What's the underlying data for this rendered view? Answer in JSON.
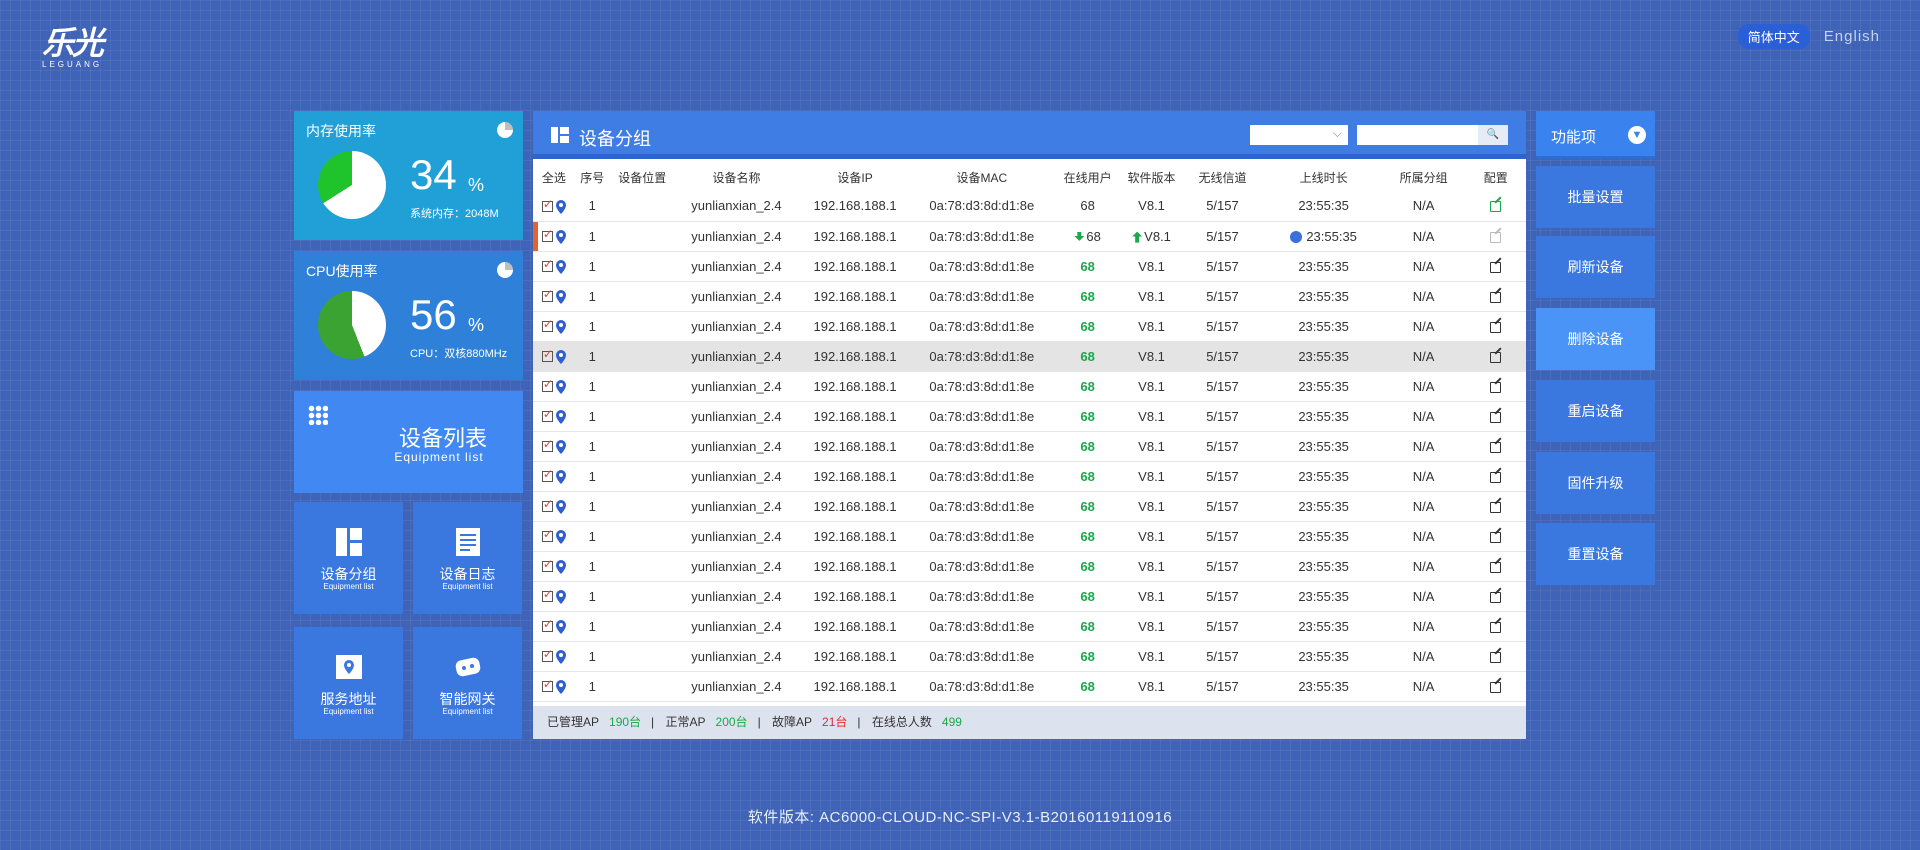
{
  "logo": {
    "mark": "乐光",
    "sub": "LEGUANG"
  },
  "language": {
    "zh": "简体中文",
    "en": "English"
  },
  "memory": {
    "title": "内存使用率",
    "value": "34",
    "unit": "%",
    "sub": "系统内存：2048M",
    "usage_percent": 34
  },
  "cpu": {
    "title": "CPU使用率",
    "value": "56",
    "unit": "%",
    "sub": "CPU：双核880MHz",
    "usage_percent": 56
  },
  "equipment_list": {
    "title": "设备列表",
    "sub": "Equipment list"
  },
  "tiles": [
    {
      "title": "设备分组",
      "sub": "Equipment list"
    },
    {
      "title": "设备日志",
      "sub": "Equipment list"
    },
    {
      "title": "服务地址",
      "sub": "Equipment list"
    },
    {
      "title": "智能网关",
      "sub": "Equipment list"
    }
  ],
  "panel": {
    "title": "设备分组",
    "search_icon": "search-icon",
    "columns": [
      "全选",
      "序号",
      "设备位置",
      "设备名称",
      "设备IP",
      "设备MAC",
      "在线用户",
      "软件版本",
      "无线信道",
      "上线时长",
      "所属分组",
      "配置"
    ],
    "rows": [
      {
        "index": "1",
        "name": "yunlianxian_2.4",
        "ip": "192.168.188.1",
        "mac": "0a:78:d3:8d:d1:8e",
        "users": "68",
        "version": "V8.1",
        "channel": "5/157",
        "uptime": "23:55:35",
        "group": "N/A"
      },
      {
        "index": "1",
        "name": "yunlianxian_2.4",
        "ip": "192.168.188.1",
        "mac": "0a:78:d3:8d:d1:8e",
        "users": "68",
        "version": "V8.1",
        "channel": "5/157",
        "uptime": "23:55:35",
        "group": "N/A"
      },
      {
        "index": "1",
        "name": "yunlianxian_2.4",
        "ip": "192.168.188.1",
        "mac": "0a:78:d3:8d:d1:8e",
        "users": "68",
        "version": "V8.1",
        "channel": "5/157",
        "uptime": "23:55:35",
        "group": "N/A"
      },
      {
        "index": "1",
        "name": "yunlianxian_2.4",
        "ip": "192.168.188.1",
        "mac": "0a:78:d3:8d:d1:8e",
        "users": "68",
        "version": "V8.1",
        "channel": "5/157",
        "uptime": "23:55:35",
        "group": "N/A"
      },
      {
        "index": "1",
        "name": "yunlianxian_2.4",
        "ip": "192.168.188.1",
        "mac": "0a:78:d3:8d:d1:8e",
        "users": "68",
        "version": "V8.1",
        "channel": "5/157",
        "uptime": "23:55:35",
        "group": "N/A"
      },
      {
        "index": "1",
        "name": "yunlianxian_2.4",
        "ip": "192.168.188.1",
        "mac": "0a:78:d3:8d:d1:8e",
        "users": "68",
        "version": "V8.1",
        "channel": "5/157",
        "uptime": "23:55:35",
        "group": "N/A"
      },
      {
        "index": "1",
        "name": "yunlianxian_2.4",
        "ip": "192.168.188.1",
        "mac": "0a:78:d3:8d:d1:8e",
        "users": "68",
        "version": "V8.1",
        "channel": "5/157",
        "uptime": "23:55:35",
        "group": "N/A"
      },
      {
        "index": "1",
        "name": "yunlianxian_2.4",
        "ip": "192.168.188.1",
        "mac": "0a:78:d3:8d:d1:8e",
        "users": "68",
        "version": "V8.1",
        "channel": "5/157",
        "uptime": "23:55:35",
        "group": "N/A"
      },
      {
        "index": "1",
        "name": "yunlianxian_2.4",
        "ip": "192.168.188.1",
        "mac": "0a:78:d3:8d:d1:8e",
        "users": "68",
        "version": "V8.1",
        "channel": "5/157",
        "uptime": "23:55:35",
        "group": "N/A"
      },
      {
        "index": "1",
        "name": "yunlianxian_2.4",
        "ip": "192.168.188.1",
        "mac": "0a:78:d3:8d:d1:8e",
        "users": "68",
        "version": "V8.1",
        "channel": "5/157",
        "uptime": "23:55:35",
        "group": "N/A"
      },
      {
        "index": "1",
        "name": "yunlianxian_2.4",
        "ip": "192.168.188.1",
        "mac": "0a:78:d3:8d:d1:8e",
        "users": "68",
        "version": "V8.1",
        "channel": "5/157",
        "uptime": "23:55:35",
        "group": "N/A"
      },
      {
        "index": "1",
        "name": "yunlianxian_2.4",
        "ip": "192.168.188.1",
        "mac": "0a:78:d3:8d:d1:8e",
        "users": "68",
        "version": "V8.1",
        "channel": "5/157",
        "uptime": "23:55:35",
        "group": "N/A"
      },
      {
        "index": "1",
        "name": "yunlianxian_2.4",
        "ip": "192.168.188.1",
        "mac": "0a:78:d3:8d:d1:8e",
        "users": "68",
        "version": "V8.1",
        "channel": "5/157",
        "uptime": "23:55:35",
        "group": "N/A"
      },
      {
        "index": "1",
        "name": "yunlianxian_2.4",
        "ip": "192.168.188.1",
        "mac": "0a:78:d3:8d:d1:8e",
        "users": "68",
        "version": "V8.1",
        "channel": "5/157",
        "uptime": "23:55:35",
        "group": "N/A"
      },
      {
        "index": "1",
        "name": "yunlianxian_2.4",
        "ip": "192.168.188.1",
        "mac": "0a:78:d3:8d:d1:8e",
        "users": "68",
        "version": "V8.1",
        "channel": "5/157",
        "uptime": "23:55:35",
        "group": "N/A"
      },
      {
        "index": "1",
        "name": "yunlianxian_2.4",
        "ip": "192.168.188.1",
        "mac": "0a:78:d3:8d:d1:8e",
        "users": "68",
        "version": "V8.1",
        "channel": "5/157",
        "uptime": "23:55:35",
        "group": "N/A"
      },
      {
        "index": "1",
        "name": "yunlianxian_2.4",
        "ip": "192.168.188.1",
        "mac": "0a:78:d3:8d:d1:8e",
        "users": "68",
        "version": "V8.1",
        "channel": "5/157",
        "uptime": "23:55:35",
        "group": "N/A"
      }
    ],
    "footer": {
      "managed_label": "已管理AP",
      "managed_value": "190台",
      "normal_label": "正常AP",
      "normal_value": "200台",
      "fault_label": "故障AP",
      "fault_value": "21台",
      "online_label": "在线总人数",
      "online_value": "499",
      "separator": "|"
    }
  },
  "functions": {
    "title": "功能项",
    "buttons": [
      "批量设置",
      "刷新设备",
      "删除设备",
      "重启设备",
      "固件升级",
      "重置设备"
    ]
  },
  "version": "软件版本: AC6000-CLOUD-NC-SPI-V3.1-B20160119110916",
  "colors": {
    "background": "#3f63b7",
    "accent": "#4288f2",
    "online_green": "#1aa84a",
    "fault_red": "#e02c2c",
    "marker_orange": "#e8612c"
  }
}
